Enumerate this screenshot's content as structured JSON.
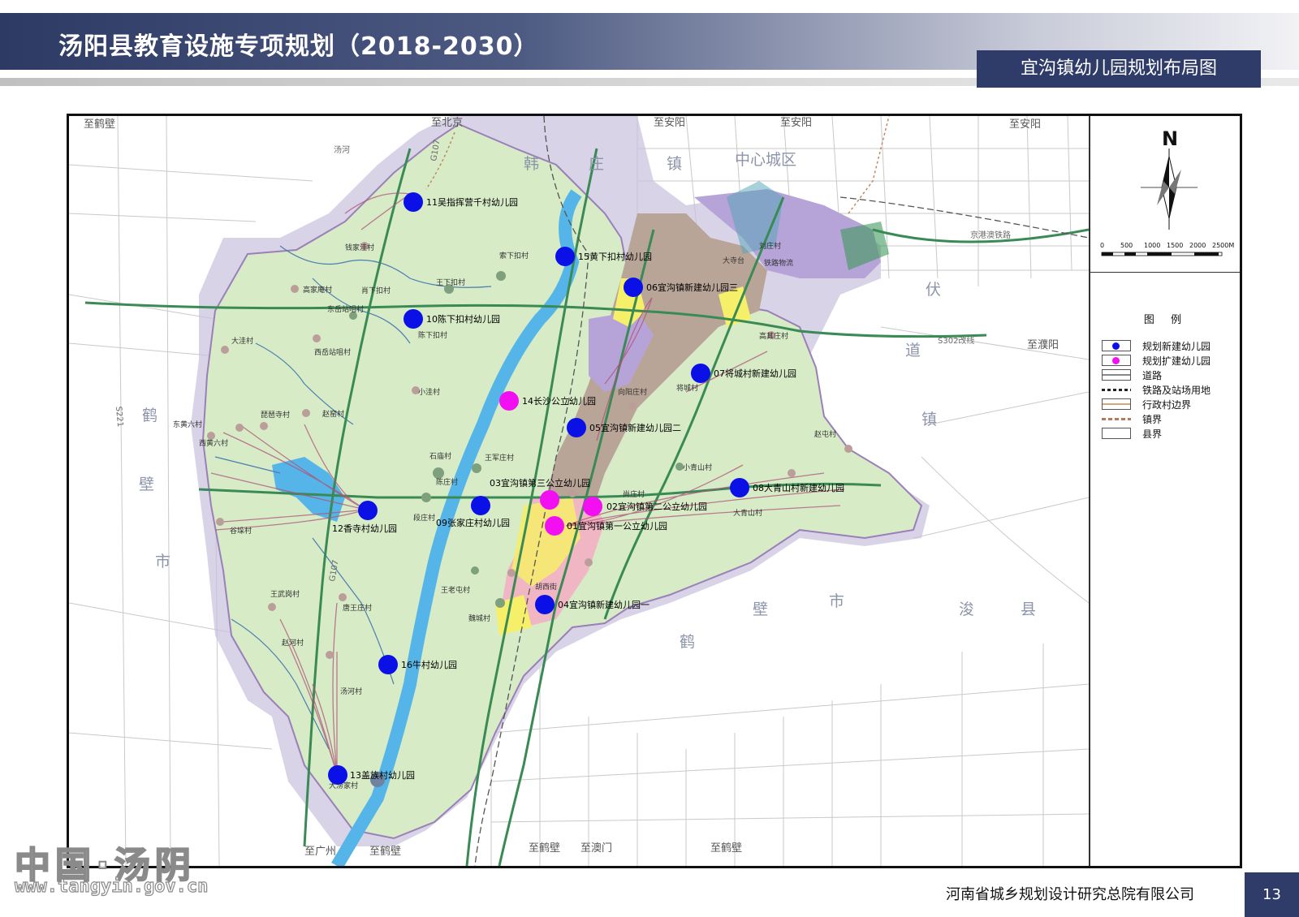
{
  "header": {
    "title": "汤阳县教育设施专项规划（2018-2030）",
    "subtitle": "宜沟镇幼儿园规划布局图"
  },
  "footer": {
    "company": "河南省城乡规划设计研究总院有限公司",
    "page": "13"
  },
  "watermark": {
    "brand": "中国·汤阴",
    "url": "www.tangyin.gov.cn"
  },
  "colors": {
    "new_kg": "#0a10e6",
    "expand_kg": "#f20ff2",
    "town": "#d8ecc9",
    "built_brown": "#b9a598",
    "built_purple": "#b6a3d8",
    "water": "#56b5e8",
    "header": "#2f3c6a"
  },
  "north_label": "N",
  "scale": {
    "ticks": [
      "0",
      "500",
      "1000",
      "1500",
      "2000",
      "2500M"
    ]
  },
  "legend": {
    "title": "图 例",
    "items": [
      {
        "label": "规划新建幼儿园",
        "symbol": "blue-dot"
      },
      {
        "label": "规划扩建幼儿园",
        "symbol": "magenta-dot"
      },
      {
        "label": "道路",
        "symbol": "road"
      },
      {
        "label": "铁路及站场用地",
        "symbol": "railway"
      },
      {
        "label": "行政村边界",
        "symbol": "village-boundary"
      },
      {
        "label": "镇界",
        "symbol": "town-boundary"
      },
      {
        "label": "县界",
        "symbol": "county-boundary"
      }
    ]
  },
  "map": {
    "directions": {
      "to_hebi_nw": "至鹤壁",
      "to_beijing": "至北京",
      "to_anyang_1": "至安阳",
      "to_anyang_2": "至安阳",
      "to_anyang_3": "至安阳",
      "to_puyang": "至濮阳",
      "to_guangzhou": "至广州",
      "to_hebi_s1": "至鹤壁",
      "to_hebi_s2": "至鹤壁",
      "to_aomen": "至澳门",
      "to_hebi_s3": "至鹤壁"
    },
    "regions": {
      "han": "韩",
      "zhuang": "庄",
      "zhen": "镇",
      "center": "中心城区",
      "fu": "伏",
      "dao": "道",
      "zhen2": "镇",
      "he": "鹤",
      "bi": "壁",
      "shi": "市",
      "bi2": "壁",
      "shi2": "市",
      "he2": "鹤",
      "jun": "浚",
      "xian": "县"
    },
    "roads": {
      "g107a": "G107",
      "g107b": "G107",
      "s221": "S221",
      "s302": "S302改线",
      "railway": "京港澳铁路",
      "tangyin_river": "汤河"
    },
    "villages": [
      "钱家洼村",
      "高家庵村",
      "肖下扣村",
      "东岳站咀村",
      "西岳站咀村",
      "大洼村",
      "小洼村",
      "琵琶寺村",
      "赵窑村",
      "东黄六村",
      "西黄六村",
      "石庙村",
      "王军庄村",
      "谷垛村",
      "王武岗村",
      "唐王庄村",
      "赵河村",
      "汤河村",
      "大涝家村",
      "索下扣村",
      "王下扣村",
      "陈下扣村",
      "王老屯村",
      "魏城村",
      "段庄村",
      "胡西街",
      "陈庄村",
      "尚庄村",
      "小青山村",
      "赵屯村",
      "高其庄村",
      "大青山村",
      "大寺台",
      "刘庄村",
      "向阳庄村",
      "将城村",
      "铁路物流"
    ],
    "kindergartens": [
      {
        "id": "01",
        "label": "01宜沟镇第一公立幼儿园",
        "type": "expand"
      },
      {
        "id": "02",
        "label": "02宜沟镇第二公立幼儿园",
        "type": "expand"
      },
      {
        "id": "03",
        "label": "03宜沟镇第三公立幼儿园",
        "type": "expand"
      },
      {
        "id": "04",
        "label": "04宜沟镇新建幼儿园一",
        "type": "new"
      },
      {
        "id": "05",
        "label": "05宜沟镇新建幼儿园二",
        "type": "new"
      },
      {
        "id": "06",
        "label": "06宜沟镇新建幼儿园三",
        "type": "new"
      },
      {
        "id": "07",
        "label": "07将城村新建幼儿园",
        "type": "new"
      },
      {
        "id": "08",
        "label": "08大青山村新建幼儿园",
        "type": "new"
      },
      {
        "id": "09",
        "label": "09张家庄村幼儿园",
        "type": "new"
      },
      {
        "id": "10",
        "label": "10陈下扣村幼儿园",
        "type": "new"
      },
      {
        "id": "11",
        "label": "11吴指挥营千村幼儿园",
        "type": "new"
      },
      {
        "id": "12",
        "label": "12香寺村幼儿园",
        "type": "new"
      },
      {
        "id": "13",
        "label": "13盖族村幼儿园",
        "type": "new"
      },
      {
        "id": "14",
        "label": "14长沙公立幼儿园",
        "type": "expand"
      },
      {
        "id": "15",
        "label": "15黄下扣村幼儿园",
        "type": "new"
      },
      {
        "id": "16",
        "label": "16牛村幼儿园",
        "type": "new"
      }
    ]
  }
}
